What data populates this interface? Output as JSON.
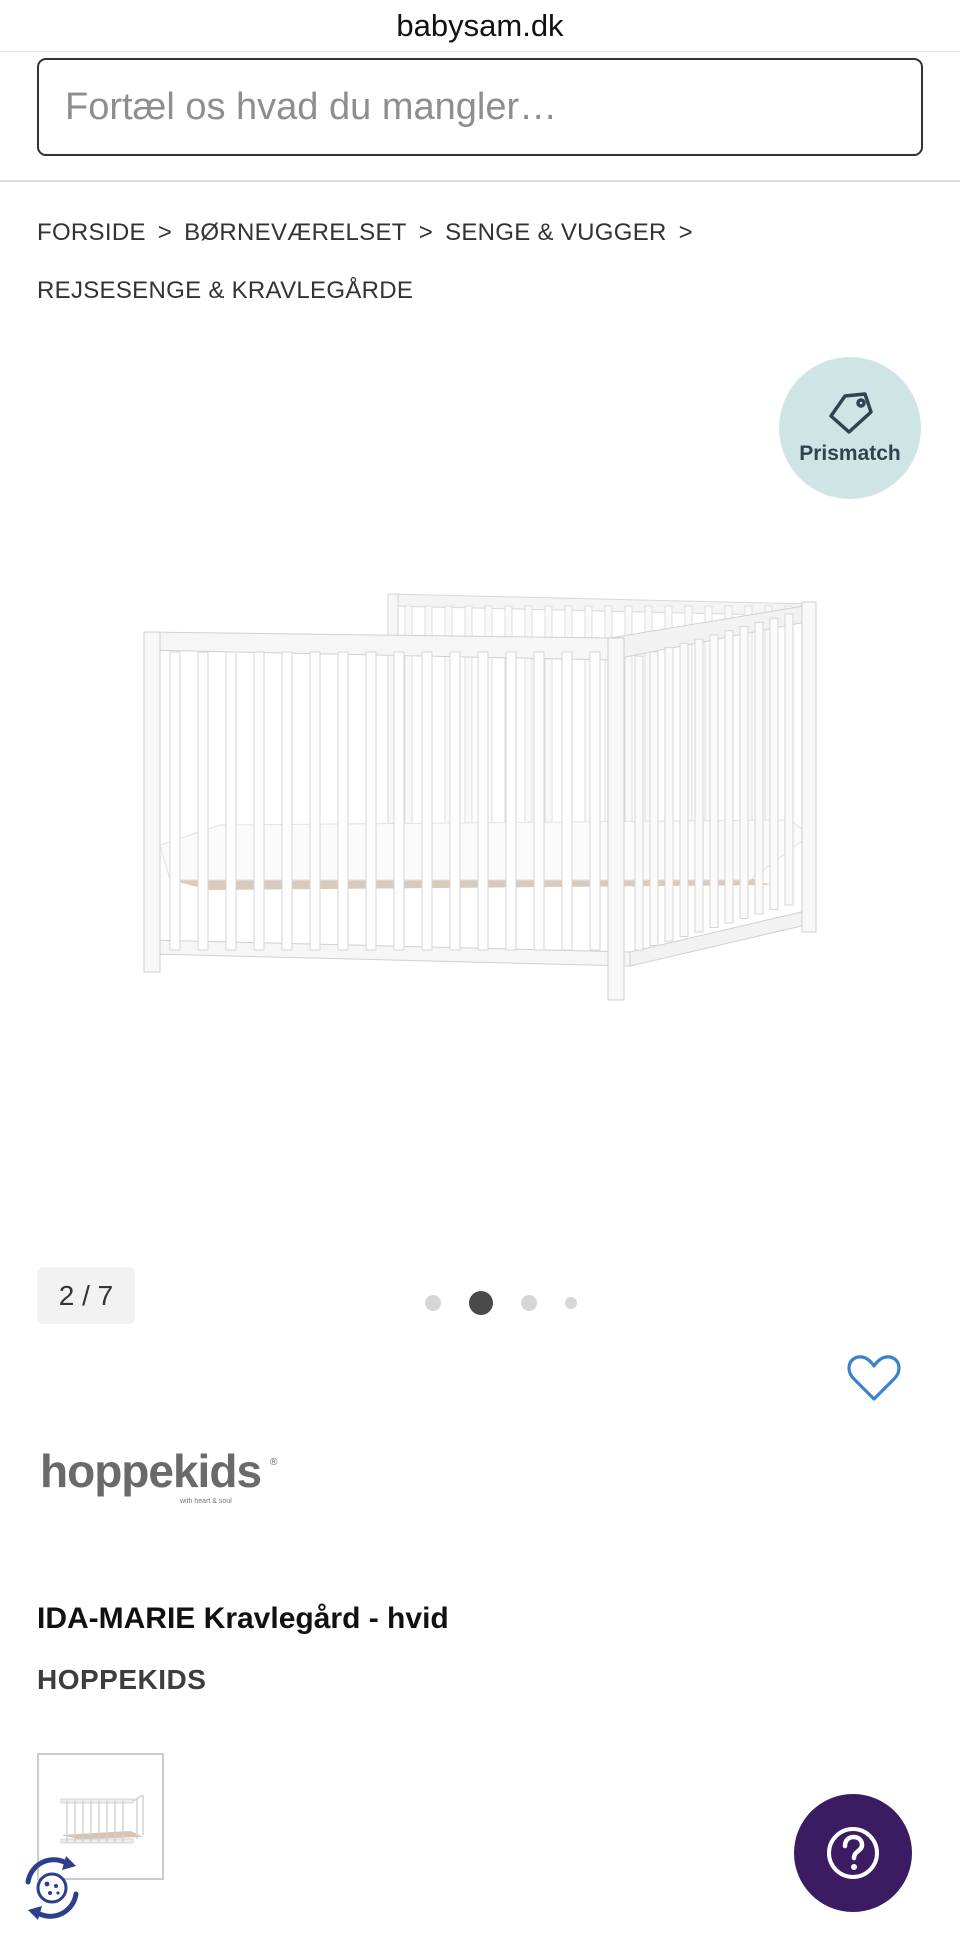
{
  "browser": {
    "url": "babysam.dk"
  },
  "search": {
    "placeholder": "Fortæl os hvad du mangler…"
  },
  "breadcrumb": {
    "separator": ">",
    "items": [
      "FORSIDE",
      "BØRNEVÆRELSET",
      "SENGE & VUGGER",
      "REJSESENGE & KRAVLEGÅRDE"
    ]
  },
  "gallery": {
    "counter": "2 / 7",
    "dots_total": 4,
    "active_dot": 1
  },
  "badge": {
    "label": "Prismatch",
    "icon": "tag-icon"
  },
  "product": {
    "title": "IDA-MARIE Kravlegård - hvid",
    "brand": "HOPPEKIDS",
    "brand_logo": {
      "text": "hoppekids",
      "tagline": "with heart & soul",
      "registered": "®"
    }
  },
  "icons": {
    "favorite": "heart-icon",
    "help": "question-icon",
    "cookie": "cookie-icon"
  },
  "colors": {
    "badge_bg": "#cfe4e4",
    "heart": "#3a82c9",
    "help_bg": "#3b1c63",
    "cookie": "#2c3f8c"
  }
}
